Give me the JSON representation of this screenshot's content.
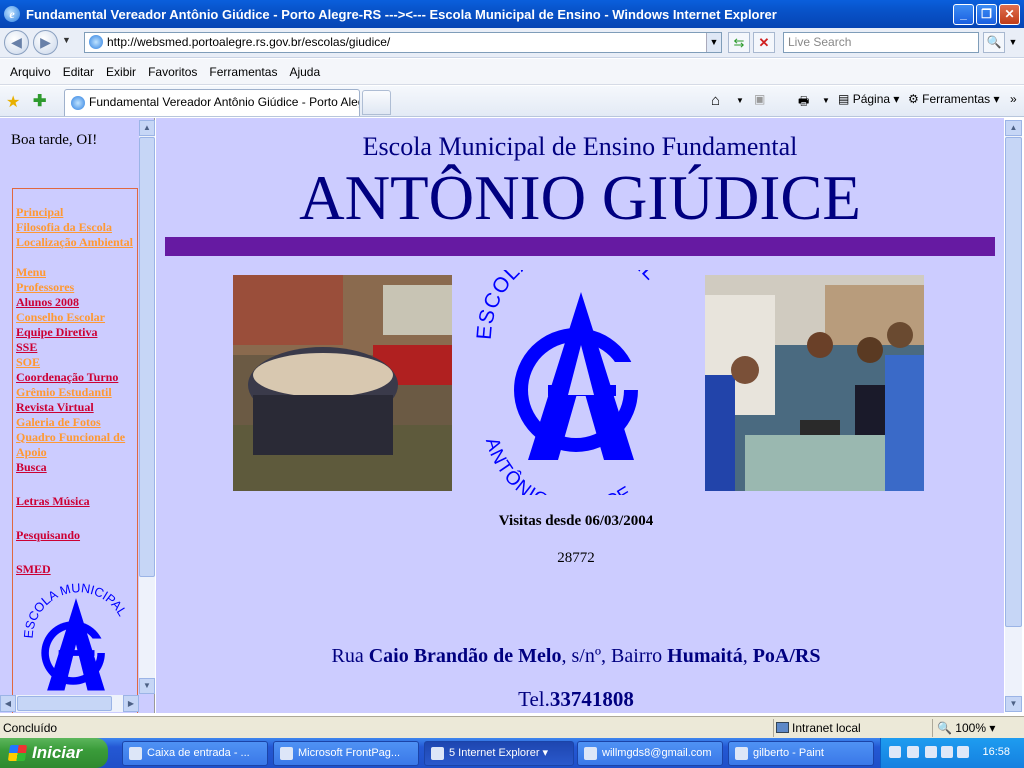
{
  "window": {
    "title": "Fundamental Vereador Antônio Giúdice - Porto Alegre-RS --->&lt;--- Escola Municipal de Ensino - Windows Internet Explorer"
  },
  "address": {
    "url": "http://websmed.portoalegre.rs.gov.br/escolas/giudice/",
    "search_placeholder": "Live Search"
  },
  "menu": [
    "Arquivo",
    "Editar",
    "Exibir",
    "Favoritos",
    "Ferramentas",
    "Ajuda"
  ],
  "tab": {
    "label": "Fundamental Vereador Antônio Giúdice - Porto Alegre..."
  },
  "toolbar": {
    "page_label": "Página",
    "tools_label": "Ferramentas"
  },
  "left": {
    "greeting": "Boa tarde, OI!",
    "nav": {
      "principal": "Principal",
      "filosofia": "Filosofia da Escola",
      "localizacao": "Localização Ambiental",
      "menu": "Menu",
      "professores": "Professores",
      "alunos": "Alunos 2008",
      "conselho": "Conselho Escolar",
      "equipe": "Equipe Diretiva",
      "sse": "SSE",
      "soe": "SOE",
      "coordenacao": "Coordenação Turno",
      "gremio": "Grêmio Estudantil",
      "revista": "Revista Virtual",
      "galeria": "Galeria de Fotos",
      "quadro1": "Quadro Funcional de",
      "quadro2": "Apoio",
      "busca": "Busca",
      "letras": "Letras Música",
      "pesquisando": "Pesquisando",
      "smed": "SMED"
    }
  },
  "main": {
    "subtitle": "Escola Municipal de Ensino Fundamental",
    "title": "ANTÔNIO GIÚDICE",
    "logo_top": "ESCOLA MUNICIPAL",
    "logo_bottom": "ANTÔNIO GIÚDICE",
    "visits_label": "Visitas desde 06/03/2004",
    "visits_count": "28772",
    "addr_rua": "Rua ",
    "addr_street": "Caio Brandão de Melo",
    "addr_mid": ", s/nº, Bairro ",
    "addr_bairro": "Humaitá",
    "addr_sep": ", ",
    "addr_city": "PoA/RS",
    "tel_label": "Tel.",
    "tel_number": "33741808"
  },
  "status": {
    "text": "Concluído",
    "zone": "Intranet local",
    "zoom": "100%"
  },
  "taskbar": {
    "start": "Iniciar",
    "tasks": [
      "Caixa de entrada - ...",
      "Microsoft FrontPag...",
      "5 Internet Explorer",
      "willmgds8@gmail.com",
      "gilberto - Paint"
    ],
    "clock": "16:58"
  },
  "colors": {
    "page_bg": "#ccccff",
    "heading": "#000080",
    "purple_bar": "#661aa2",
    "link_orange": "#ff9933",
    "link_red": "#cc0033",
    "logo_blue": "#0000ff"
  }
}
